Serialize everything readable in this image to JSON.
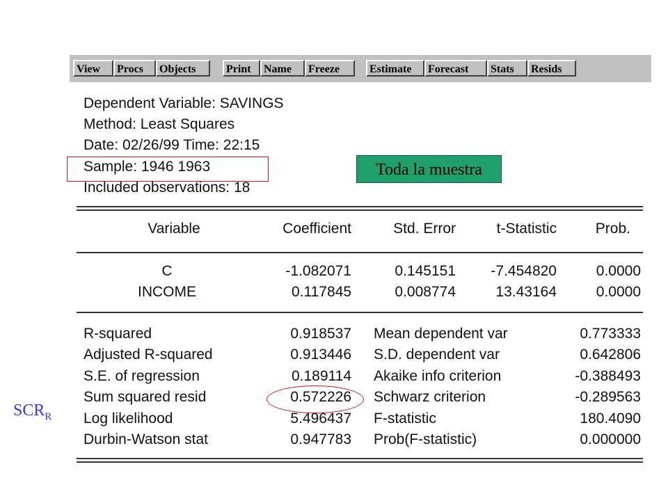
{
  "toolbar": {
    "buttons": [
      "View",
      "Procs",
      "Objects",
      "Print",
      "Name",
      "Freeze",
      "Estimate",
      "Forecast",
      "Stats",
      "Resids"
    ]
  },
  "header": {
    "dependent": "Dependent Variable: SAVINGS",
    "method": "Method: Least Squares",
    "date": "Date: 02/26/99   Time: 22:15",
    "sample": "Sample: 1946 1963",
    "included": "Included observations: 18"
  },
  "coef_table": {
    "columns": [
      "Variable",
      "Coefficient",
      "Std. Error",
      "t-Statistic",
      "Prob."
    ],
    "rows": [
      [
        "C",
        "-1.082071",
        "0.145151",
        "-7.454820",
        "0.0000"
      ],
      [
        "INCOME",
        "0.117845",
        "0.008774",
        "13.43164",
        "0.0000"
      ]
    ]
  },
  "stats": {
    "rows": [
      [
        "R-squared",
        "0.918537",
        "Mean dependent var",
        "0.773333"
      ],
      [
        "Adjusted R-squared",
        "0.913446",
        "S.D. dependent var",
        "0.642806"
      ],
      [
        "S.E. of regression",
        "0.189114",
        "Akaike info criterion",
        "-0.388493"
      ],
      [
        "Sum squared resid",
        "0.572226",
        "Schwarz criterion",
        "-0.289563"
      ],
      [
        "Log likelihood",
        "5.496437",
        "F-statistic",
        "180.4090"
      ],
      [
        "Durbin-Watson stat",
        "0.947783",
        "Prob(F-statistic)",
        "0.000000"
      ]
    ]
  },
  "annotations": {
    "toda": "Toda la muestra",
    "scr_main": "SCR",
    "scr_sub": "R",
    "accent_green": "#1f9f6c",
    "annotation_blue": "#3333ff",
    "circle_red": "#d01818"
  }
}
